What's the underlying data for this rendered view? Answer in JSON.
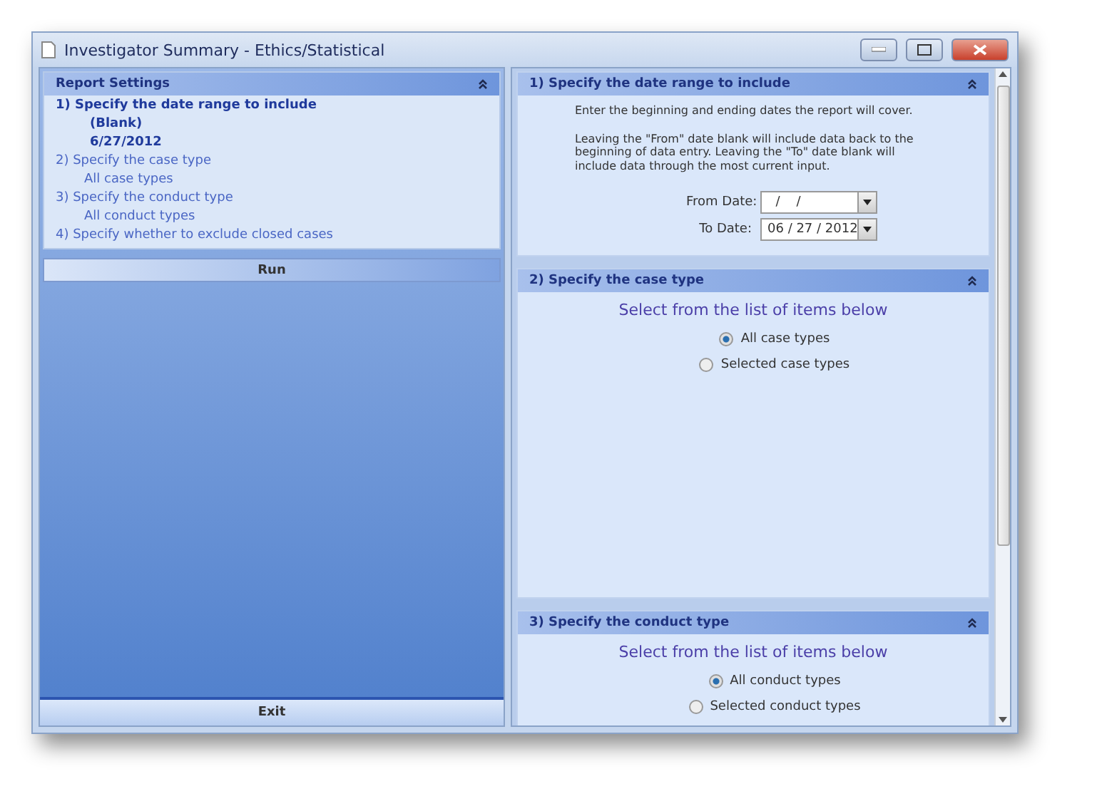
{
  "window": {
    "title": "Investigator Summary - Ethics/Statistical"
  },
  "report_settings": {
    "title": "Report Settings",
    "steps": [
      {
        "label": "1)  Specify the date range to include",
        "selected": true,
        "values": [
          "(Blank)",
          "6/27/2012"
        ]
      },
      {
        "label": "2)  Specify the case type",
        "selected": false,
        "values": [
          "All case types"
        ]
      },
      {
        "label": "3)  Specify the conduct type",
        "selected": false,
        "values": [
          "All conduct types"
        ]
      },
      {
        "label": "4)  Specify whether to exclude closed cases",
        "selected": false
      }
    ]
  },
  "run_button": "Run",
  "exit_button": "Exit",
  "sections": [
    {
      "kind": "dates",
      "title": "1)  Specify the date range to include",
      "paragraphs": [
        "Enter the beginning and ending dates the report will cover.",
        "Leaving the \"From\" date blank will include data back to the beginning of data entry.  Leaving the \"To\" date blank will include data through the most current input."
      ],
      "fields": [
        {
          "label": "From Date:",
          "value": "  /    /"
        },
        {
          "label": "To Date:",
          "value": "06 / 27 / 2012"
        }
      ]
    },
    {
      "kind": "radio",
      "title": "2)  Specify the case type",
      "prompt": "Select from the list of items below",
      "options": [
        {
          "label": "All case types",
          "selected": true
        },
        {
          "label": "Selected case types",
          "selected": false
        }
      ]
    },
    {
      "kind": "radio",
      "title": "3)  Specify the conduct type",
      "prompt": "Select from the list of items below",
      "options": [
        {
          "label": "All conduct types",
          "selected": true
        },
        {
          "label": "Selected conduct types",
          "selected": false
        }
      ]
    }
  ]
}
